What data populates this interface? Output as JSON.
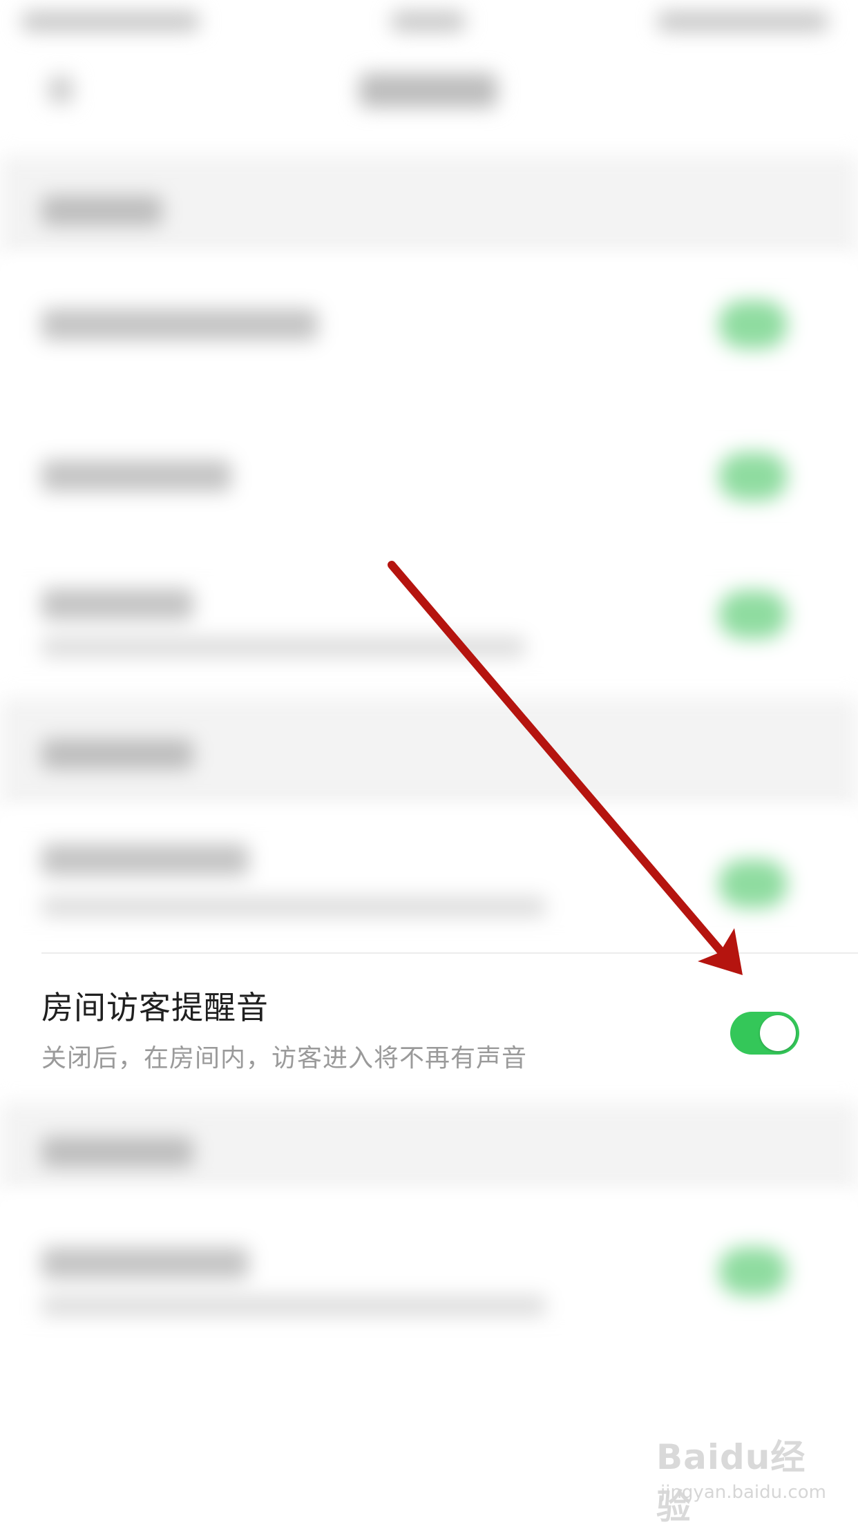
{
  "focused_setting": {
    "title": "房间访客提醒音",
    "subtitle": "关闭后，在房间内，访客进入将不再有声音",
    "toggle": {
      "state": "on",
      "color": "#34c759"
    }
  },
  "annotation": {
    "type": "arrow",
    "color": "#b5140f"
  },
  "watermark": {
    "logo_text": "Baidu经验",
    "url": "jingyan.baidu.com"
  },
  "colors": {
    "background": "#ffffff",
    "section_bg": "#f3f3f3"
  }
}
